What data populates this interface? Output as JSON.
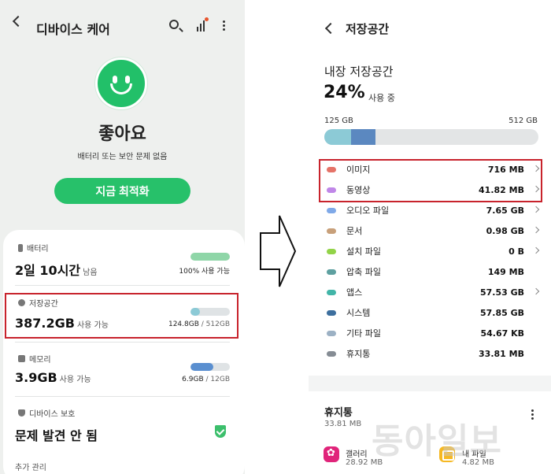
{
  "left": {
    "title": "디바이스 케어",
    "status": "좋아요",
    "status_sub": "배터리 또는 보안 문제 없음",
    "optimize_button": "지금 최적화",
    "battery": {
      "label": "배터리",
      "value": "2일 10시간",
      "value_unit": "남음",
      "right": "100% 사용 가능",
      "fill": 1.0,
      "color": "#8fd6a8"
    },
    "storage": {
      "label": "저장공간",
      "value": "387.2GB",
      "value_unit": "사용 가능",
      "right_used": "124.8GB",
      "right_total": " / 512GB",
      "fill": 0.24,
      "color": "#8ccad6"
    },
    "memory": {
      "label": "메모리",
      "value": "3.9GB",
      "value_unit": "사용 가능",
      "right_used": "6.9GB",
      "right_total": " / 12GB",
      "fill": 0.575,
      "color": "#5a8fd0"
    },
    "protection": {
      "label": "디바이스 보호",
      "value": "문제 발견 안 됨"
    },
    "more_label": "추가 관리"
  },
  "right": {
    "title": "저장공간",
    "inner_label": "내장 저장공간",
    "percent": "24%",
    "percent_sub": "사용 중",
    "used": "125 GB",
    "total": "512 GB",
    "bar_segments": [
      {
        "fraction": 0.125,
        "color": "#8ccad6"
      },
      {
        "fraction": 0.115,
        "color": "#5b88c0"
      }
    ],
    "categories": [
      {
        "name": "이미지",
        "size": "716 MB",
        "color": "#e57368",
        "chevron": true
      },
      {
        "name": "동영상",
        "size": "41.82 MB",
        "color": "#c087e8",
        "chevron": true
      },
      {
        "name": "오디오 파일",
        "size": "7.65 GB",
        "color": "#7fa9e8",
        "chevron": true
      },
      {
        "name": "문서",
        "size": "0.98 GB",
        "color": "#c8a07a",
        "chevron": true
      },
      {
        "name": "설치 파일",
        "size": "0 B",
        "color": "#92d348",
        "chevron": true
      },
      {
        "name": "압축 파일",
        "size": "149 MB",
        "color": "#5ea0a0",
        "chevron": false
      },
      {
        "name": "앱스",
        "size": "57.53 GB",
        "color": "#42b5a8",
        "chevron": true
      },
      {
        "name": "시스템",
        "size": "57.85 GB",
        "color": "#3d6f9e",
        "chevron": false
      },
      {
        "name": "기타 파일",
        "size": "54.67 KB",
        "color": "#9cb1c4",
        "chevron": false
      },
      {
        "name": "휴지통",
        "size": "33.81 MB",
        "color": "#858c94",
        "chevron": false
      }
    ],
    "trash": {
      "title": "휴지통",
      "size": "33.81 MB",
      "apps": [
        {
          "name": "갤러리",
          "size": "28.92 MB"
        },
        {
          "name": "내 파일",
          "size": "4.82 MB"
        }
      ]
    }
  },
  "watermark": "동아일보"
}
